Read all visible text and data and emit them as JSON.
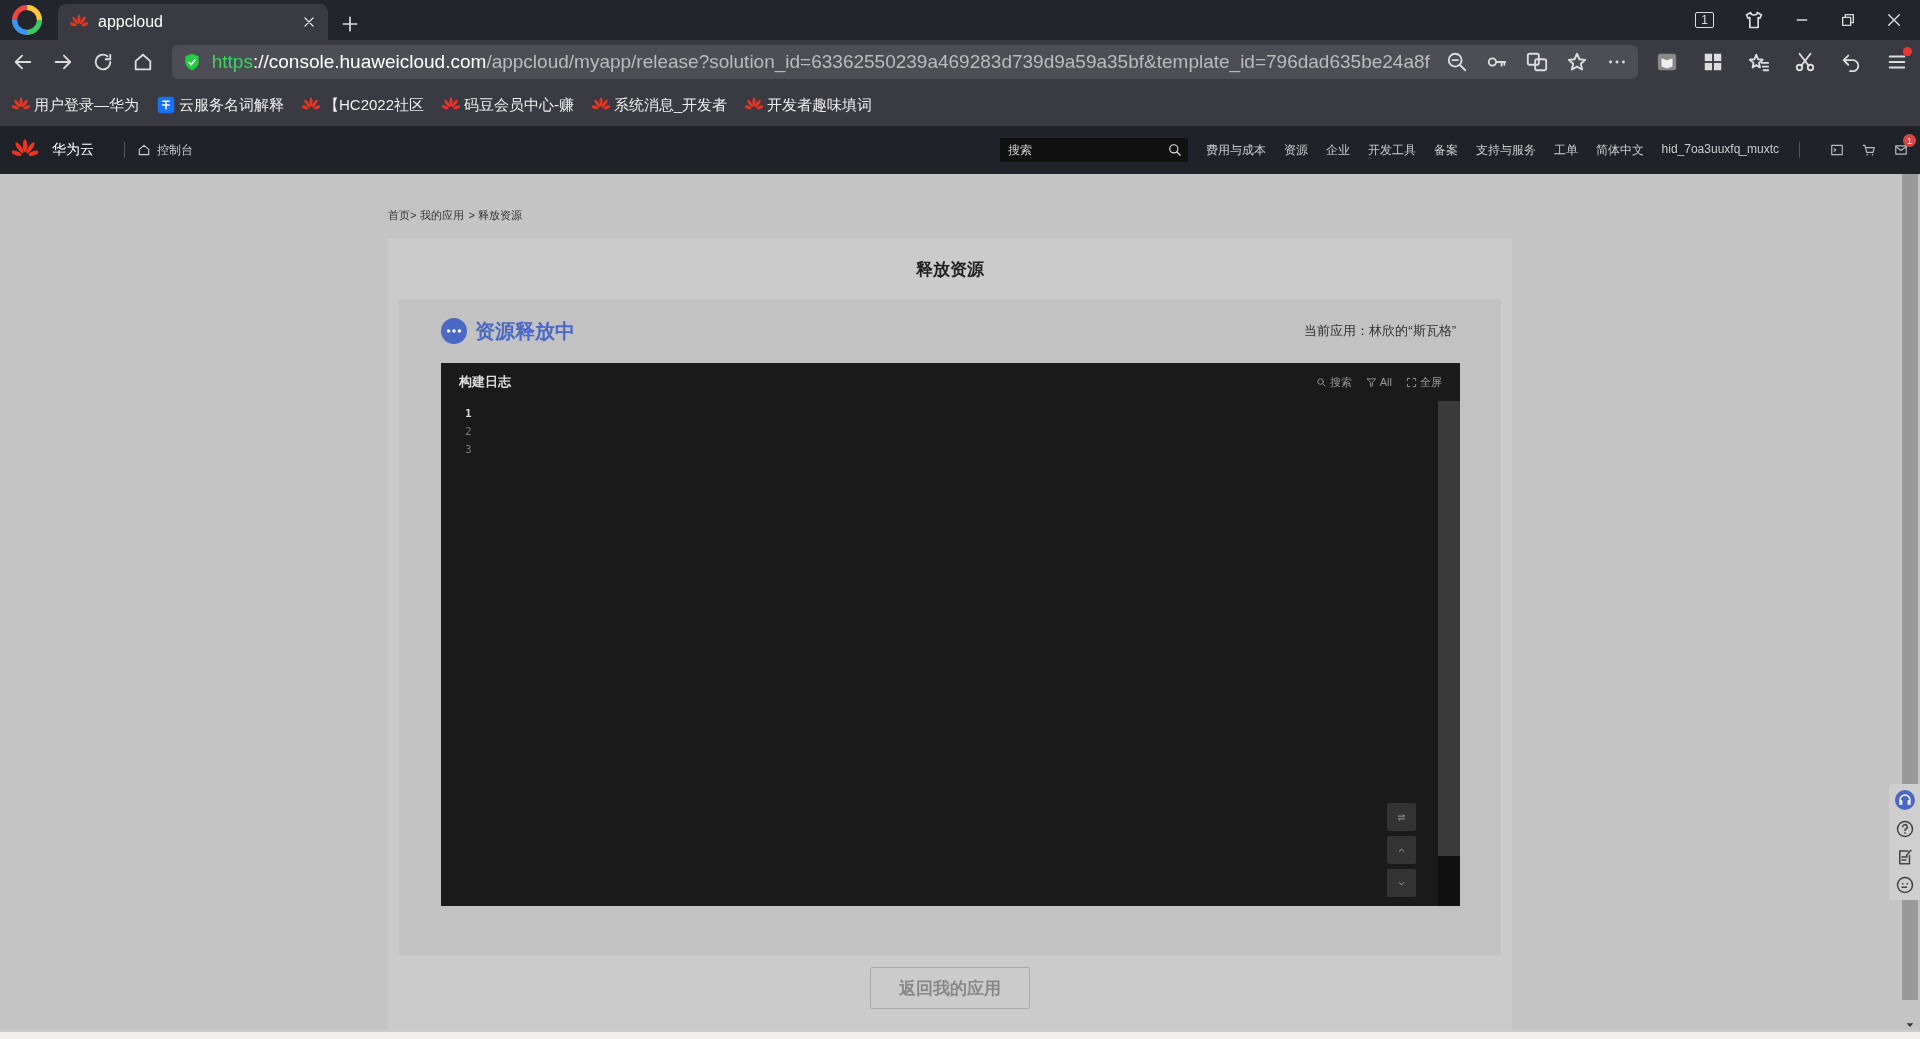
{
  "browser": {
    "tabs": [
      {
        "title": "appcloud",
        "selected": true
      }
    ],
    "window_count": "1",
    "address": {
      "scheme": "https",
      "host": "://console.huaweicloud.com",
      "path": "/appcloud/myapp/release?solution_id=63362550239a469283d739d9a59a35bf&template_id=796dad635be24a8f"
    },
    "bookmarks": [
      {
        "label": "用户登录—华为",
        "kind": "flower"
      },
      {
        "label": "云服务名词解释",
        "kind": "badge"
      },
      {
        "label": "【HC2022社区",
        "kind": "flower"
      },
      {
        "label": "码豆会员中心-赚",
        "kind": "flower"
      },
      {
        "label": "系统消息_开发者",
        "kind": "flower"
      },
      {
        "label": "开发者趣味填词",
        "kind": "flower"
      }
    ],
    "menu_has_alert": true
  },
  "console": {
    "brand": "华为云",
    "console_link": "控制台",
    "search": {
      "placeholder": "搜索"
    },
    "nav": [
      "费用与成本",
      "资源",
      "企业",
      "开发工具",
      "备案",
      "支持与服务",
      "工单",
      "简体中文",
      "hid_7oa3uuxfq_muxtc"
    ],
    "message_count": "1"
  },
  "breadcrumb": [
    "首页>",
    "我的应用",
    "> 释放资源"
  ],
  "page_title": "释放资源",
  "status": {
    "label": "资源释放中",
    "current_app": "当前应用：林欣的“斯瓦格”"
  },
  "log": {
    "title": "构建日志",
    "tools": [
      {
        "kind": "search",
        "label": "搜索"
      },
      {
        "kind": "filter",
        "label": "All"
      },
      {
        "kind": "fullscreen",
        "label": "全屏"
      }
    ],
    "lines": [
      {
        "number": "1",
        "current": true
      },
      {
        "number": "2",
        "current": false
      },
      {
        "number": "3",
        "current": false
      }
    ],
    "scroll_buttons": [
      {
        "kind": "wrap"
      },
      {
        "kind": "up"
      },
      {
        "kind": "down"
      }
    ]
  },
  "return_button": "返回我的应用"
}
